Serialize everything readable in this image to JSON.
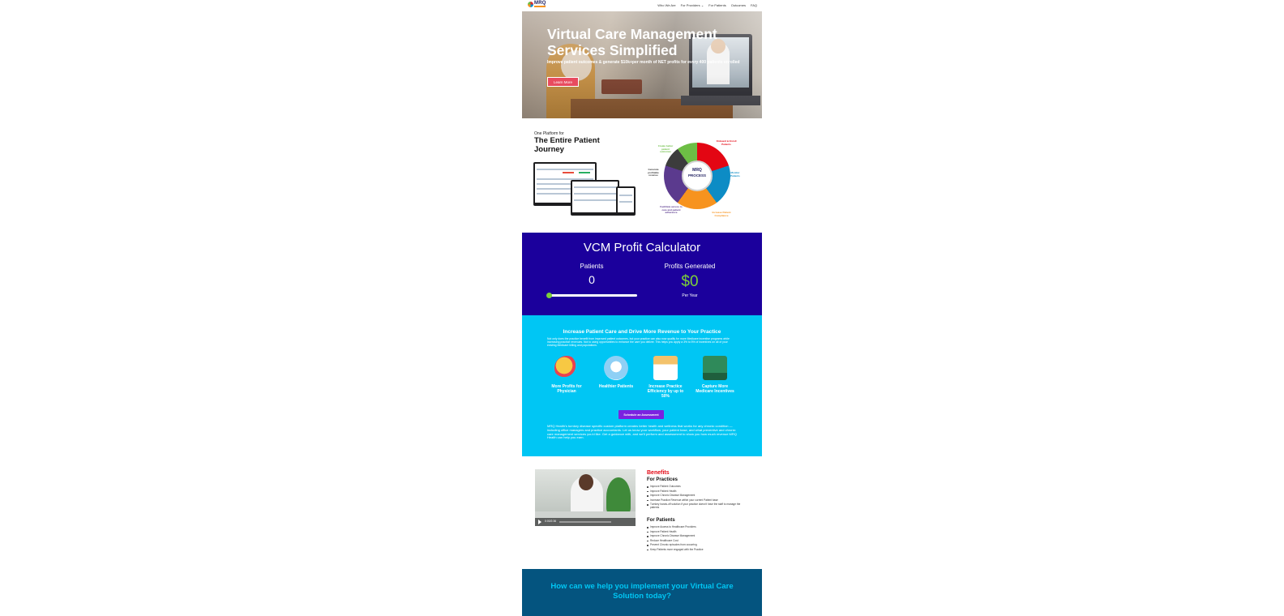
{
  "header": {
    "logo_text": "MRQ",
    "nav": [
      "Who We Are",
      "For Providers",
      "For Patients",
      "Outcomes",
      "FAQ"
    ]
  },
  "hero": {
    "title": "Virtual Care Management Services Simplified",
    "subtitle": "Improve patient outcomes & generate $10k+per month of NET profits for every 400 patients enrolled",
    "button": "Learn More"
  },
  "platform": {
    "kicker": "One Platform for",
    "title": "The Entire Patient Journey",
    "process": {
      "center_brand": "MRQ",
      "center_label": "PROCESS",
      "labels": [
        "Onboard & Enroll Patients",
        "Monitor Patients",
        "Increase Patient Compliance",
        "Facilitate access to care and patient adherence",
        "Generate profitable revenue",
        "Create better patient outcomes"
      ]
    }
  },
  "calculator": {
    "title": "VCM Profit Calculator",
    "patients_label": "Patients",
    "patients_value": "0",
    "profits_label": "Profits Generated",
    "profits_value": "$0",
    "per_year": "Per Year",
    "slider_level": 0,
    "colors": {
      "background": "#1b009c",
      "accent": "#7cd03a"
    }
  },
  "care": {
    "title": "Increase Patient Care and Drive More Revenue to Your Practice",
    "body": "Not only does the practice benefit from improved patient outcomes, but your practice can also now qualify for more Medicare incentive programs while increasing practice revenues. Not to using opportunities to enhance the care you deliver. This helps you apply a 3% to 5% of incentives on all of your existing Medicare billing and populations.",
    "features": [
      {
        "label": "More Profits for Physician",
        "icon": "money-icon"
      },
      {
        "label": "Healthier Patients",
        "icon": "stethoscope-icon"
      },
      {
        "label": "Increase Practice Efficiency by up to 50%",
        "icon": "chart-icon"
      },
      {
        "label": "Capture More Medicare Incentives",
        "icon": "monitor-icon"
      }
    ],
    "button": "Schedule an Assessment",
    "footer": "MRQ Health's turnkey disease specific custom platform creates better health and wellness that works for any chronic condition — including office managers and practice accountants. Let us know your workflow, your patient base, and what preventive and chronic care management services you'd like. Get a guidance with, and we'll perform and assessment to show you how much revenue MRQ Health can help you earn."
  },
  "benefits": {
    "title": "Benefits",
    "practices_title": "For Practices",
    "practices": [
      "Improve Patient Outcomes",
      "Improve Patient Health",
      "Improve Chronic Disease Management",
      "Increase Practice Revenue within your current Patient base",
      "Turnkey hands-off solution if your practice doesn't have the staff to manage the patients"
    ],
    "patients_title": "For Patients",
    "patients": [
      "Improve Access to Healthcare Providers",
      "Improve Patient Health",
      "Improve Chronic Disease Management",
      "Reduce Healthcare Cost",
      "Prevent Chronic episodes from occurring",
      "Keep Patients more engaged with the Practice"
    ],
    "video_time": "0:00/2:36"
  },
  "help": {
    "title": "How can we help you implement your Virtual Care Solution today?"
  }
}
